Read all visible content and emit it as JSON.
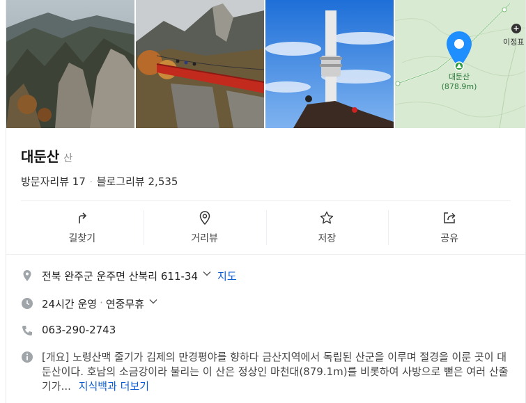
{
  "place": {
    "name": "대둔산",
    "category": "산"
  },
  "reviews": {
    "visitor_label": "방문자리뷰",
    "visitor_count": "17",
    "blog_label": "블로그리뷰",
    "blog_count": "2,535"
  },
  "map": {
    "peak_name": "대둔산",
    "peak_height": "(878.9m)",
    "poi_label": "이정표"
  },
  "photos": [
    {
      "icon": "mountain-rocks-photo"
    },
    {
      "icon": "suspension-bridge-photo"
    },
    {
      "icon": "summit-monument-photo"
    }
  ],
  "actions": [
    {
      "label": "길찾기",
      "icon": "directions-icon"
    },
    {
      "label": "거리뷰",
      "icon": "streetview-icon"
    },
    {
      "label": "저장",
      "icon": "star-icon"
    },
    {
      "label": "공유",
      "icon": "share-icon"
    }
  ],
  "info": {
    "address": "전북 완주군 운주면 산북리 611-34",
    "map_link": "지도",
    "hours": "24시간 운영",
    "holiday": "연중무휴",
    "phone": "063-290-2743",
    "description": "[개요] 노령산맥 줄기가 김제의 만경평야를 향하다 금산지역에서 독립된 산군을 이루며 절경을 이룬 곳이 대둔산이다. 호남의 소금강이라 불리는 이 산은 정상인 마천대(879.1m)를 비롯하여 사방으로 뻗은 여러 산줄기가...",
    "more_link": "지식백과 더보기"
  },
  "colors": {
    "link": "#0a5bd3",
    "map_bg": "#d9ead3",
    "pin": "#1f8fff"
  }
}
